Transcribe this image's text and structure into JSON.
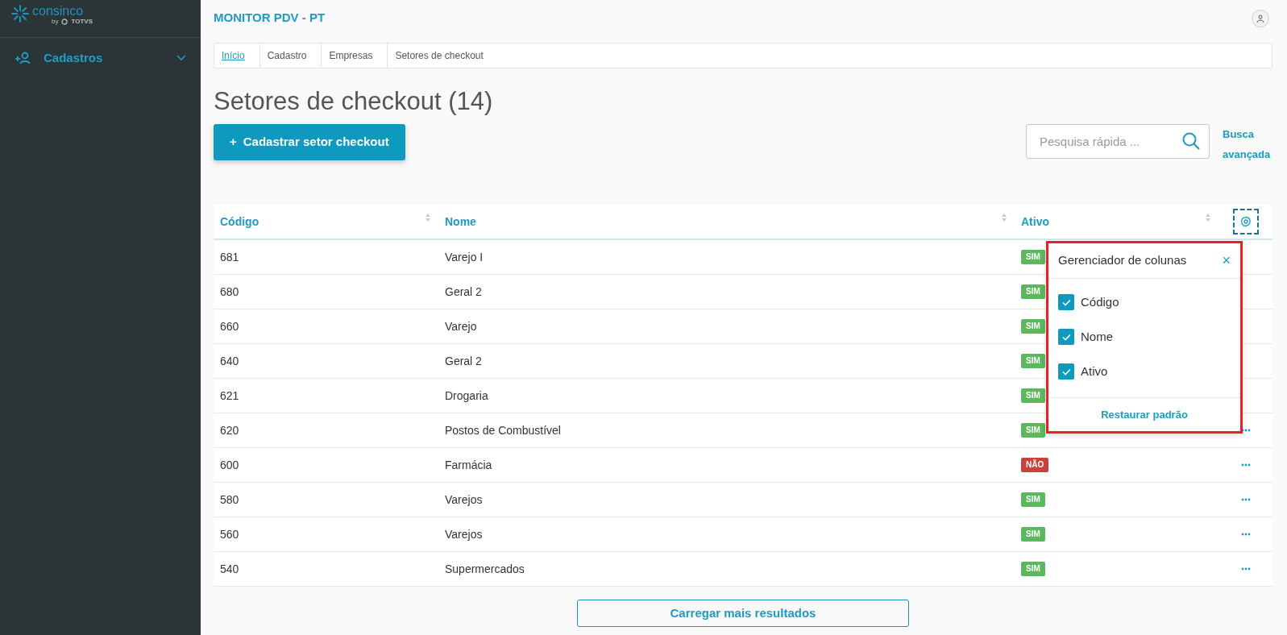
{
  "sidebar": {
    "logo": {
      "name": "consinco",
      "by": "by",
      "brand": "TOTVS"
    },
    "items": [
      {
        "label": "Cadastros",
        "expanded": false
      }
    ]
  },
  "header": {
    "title": "MONITOR PDV - PT"
  },
  "breadcrumb": [
    {
      "label": "Início",
      "link": true
    },
    {
      "label": "Cadastro",
      "link": false
    },
    {
      "label": "Empresas",
      "link": false
    },
    {
      "label": "Setores de checkout",
      "link": false
    }
  ],
  "page_title": "Setores de checkout (14)",
  "primary_button": {
    "icon": "+",
    "label": "Cadastrar setor checkout"
  },
  "search": {
    "placeholder": "Pesquisa rápida ..."
  },
  "advanced_search": "Busca avançada",
  "table": {
    "columns": [
      "Código",
      "Nome",
      "Ativo"
    ],
    "rows": [
      {
        "code": "681",
        "name": "Varejo I",
        "active": true,
        "status": "SIM",
        "menu_visible": false
      },
      {
        "code": "680",
        "name": "Geral 2",
        "active": true,
        "status": "SIM",
        "menu_visible": false
      },
      {
        "code": "660",
        "name": "Varejo",
        "active": true,
        "status": "SIM",
        "menu_visible": false
      },
      {
        "code": "640",
        "name": "Geral 2",
        "active": true,
        "status": "SIM",
        "menu_visible": false
      },
      {
        "code": "621",
        "name": "Drogaria",
        "active": true,
        "status": "SIM",
        "menu_visible": false
      },
      {
        "code": "620",
        "name": "Postos de Combustível",
        "active": true,
        "status": "SIM",
        "menu_visible": true
      },
      {
        "code": "600",
        "name": "Farmácia",
        "active": false,
        "status": "NÃO",
        "menu_visible": true
      },
      {
        "code": "580",
        "name": "Varejos",
        "active": true,
        "status": "SIM",
        "menu_visible": true
      },
      {
        "code": "560",
        "name": "Varejos",
        "active": true,
        "status": "SIM",
        "menu_visible": true
      },
      {
        "code": "540",
        "name": "Supermercados",
        "active": true,
        "status": "SIM",
        "menu_visible": true
      }
    ]
  },
  "column_manager": {
    "title": "Gerenciador de colunas",
    "close": "×",
    "options": [
      {
        "label": "Código",
        "checked": true
      },
      {
        "label": "Nome",
        "checked": true
      },
      {
        "label": "Ativo",
        "checked": true
      }
    ],
    "reset": "Restaurar padrão"
  },
  "load_more": "Carregar mais resultados"
}
